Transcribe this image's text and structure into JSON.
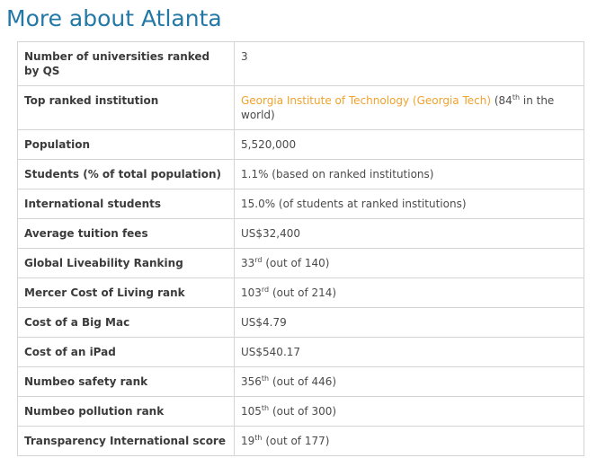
{
  "page": {
    "title": "More about Atlanta"
  },
  "rows": [
    {
      "label": "Number of universities ranked by QS",
      "value": "3"
    },
    {
      "label": "Top ranked institution",
      "link_text": "Georgia Institute of Technology (Georgia Tech)",
      "rank": "84",
      "rank_suffix": "th",
      "rest": " in the world)"
    },
    {
      "label": "Population",
      "value": "5,520,000"
    },
    {
      "label": "Students (% of total population)",
      "value": "1.1% (based on ranked institutions)"
    },
    {
      "label": "International students",
      "value": "15.0% (of students at ranked institutions)"
    },
    {
      "label": "Average tuition fees",
      "value": "US$32,400"
    },
    {
      "label": "Global Liveability Ranking",
      "rank": "33",
      "rank_suffix": "rd",
      "rest": " (out of 140)"
    },
    {
      "label": "Mercer Cost of Living rank",
      "rank": "103",
      "rank_suffix": "rd",
      "rest": " (out of 214)"
    },
    {
      "label": "Cost of a Big Mac",
      "value": "US$4.79"
    },
    {
      "label": "Cost of an iPad",
      "value": "US$540.17"
    },
    {
      "label": "Numbeo safety rank",
      "rank": "356",
      "rank_suffix": "th",
      "rest": " (out of 446)"
    },
    {
      "label": "Numbeo pollution rank",
      "rank": "105",
      "rank_suffix": "th",
      "rest": " (out of 300)"
    },
    {
      "label": "Transparency International score",
      "rank": "19",
      "rank_suffix": "th",
      "rest": " (out of 177)"
    }
  ],
  "colors": {
    "title": "#2378a6",
    "link": "#f0a22e",
    "border": "#d4d4d4",
    "text": "#4a4a4a"
  }
}
